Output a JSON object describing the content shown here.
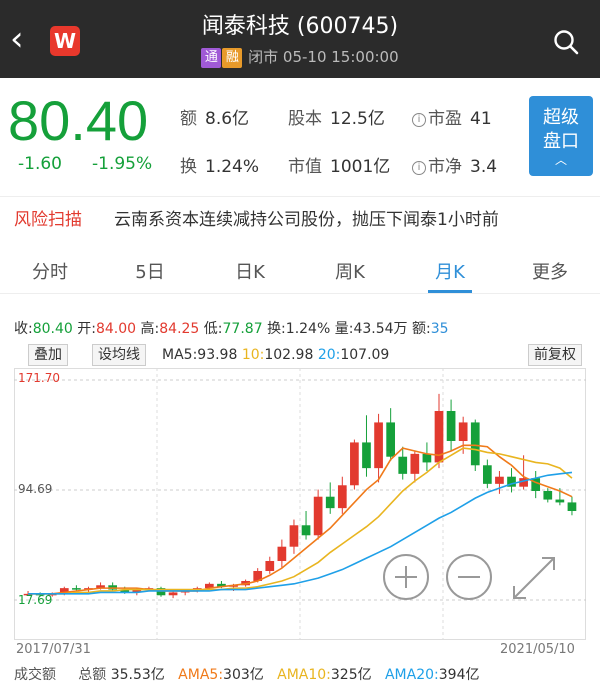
{
  "header": {
    "title": "闻泰科技 (600745)",
    "badge_tong": "通",
    "badge_rong": "融",
    "status": "闭市 05-10 15:00:00",
    "app_logo": "W"
  },
  "quote": {
    "price": "80.40",
    "change": "-1.60",
    "change_pct": "-1.95%",
    "amount_label": "额",
    "amount": "8.6亿",
    "turnover_label": "换",
    "turnover": "1.24%",
    "shares_label": "股本",
    "shares": "12.5亿",
    "mktcap_label": "市值",
    "mktcap": "1001亿",
    "pe_label": "市盈",
    "pe": "41",
    "pb_label": "市净",
    "pb": "3.4",
    "super_btn_line1": "超级",
    "super_btn_line2": "盘口",
    "price_color": "#15a03a"
  },
  "risk": {
    "tag": "风险扫描",
    "message": "云南系资本连续减持公司股份，抛压下闻泰1小时前"
  },
  "tabs": [
    "分时",
    "5日",
    "日K",
    "周K",
    "月K",
    "更多"
  ],
  "active_tab": "月K",
  "ohlc": {
    "close_label": "收:",
    "close": "80.40",
    "open_label": "开:",
    "open": "84.00",
    "high_label": "高:",
    "high": "84.25",
    "low_label": "低:",
    "low": "77.87",
    "turn_label": "换:",
    "turn": "1.24%",
    "vol_label": "量:",
    "vol": "43.54万",
    "amt_label": "额:",
    "amt": "35"
  },
  "chart_toolbar": {
    "overlay": "叠加",
    "set_ma": "设均线",
    "ma5_label": "MA5:",
    "ma5": "93.98",
    "ma10_label": "10:",
    "ma10": "102.98",
    "ma20_label": "20:",
    "ma20": "107.09",
    "adjust": "前复权"
  },
  "chart_data": {
    "type": "candlestick",
    "y_labels": [
      "171.70",
      "94.69",
      "17.69"
    ],
    "ylim": [
      17.69,
      171.7
    ],
    "x_start": "2017/07/31",
    "x_end": "2021/05/10",
    "candles": [
      [
        22,
        24,
        21,
        22
      ],
      [
        22,
        23,
        20,
        21
      ],
      [
        21,
        23,
        20,
        22
      ],
      [
        22,
        27,
        21,
        26
      ],
      [
        26,
        28,
        24,
        25
      ],
      [
        25,
        27,
        23,
        26
      ],
      [
        26,
        30,
        25,
        28
      ],
      [
        28,
        30,
        24,
        25
      ],
      [
        25,
        27,
        22,
        23
      ],
      [
        23,
        26,
        21,
        25
      ],
      [
        25,
        27,
        24,
        26
      ],
      [
        26,
        27,
        20,
        21
      ],
      [
        21,
        24,
        19,
        23
      ],
      [
        23,
        25,
        21,
        24
      ],
      [
        24,
        27,
        23,
        26
      ],
      [
        26,
        30,
        25,
        29
      ],
      [
        29,
        31,
        26,
        27
      ],
      [
        27,
        29,
        24,
        28
      ],
      [
        28,
        32,
        27,
        31
      ],
      [
        31,
        40,
        30,
        38
      ],
      [
        38,
        48,
        36,
        45
      ],
      [
        45,
        60,
        40,
        55
      ],
      [
        55,
        74,
        50,
        70
      ],
      [
        70,
        80,
        60,
        63
      ],
      [
        63,
        95,
        60,
        90
      ],
      [
        90,
        100,
        78,
        82
      ],
      [
        82,
        104,
        78,
        98
      ],
      [
        98,
        130,
        95,
        128
      ],
      [
        128,
        147,
        104,
        110
      ],
      [
        110,
        148,
        100,
        142
      ],
      [
        142,
        152,
        115,
        118
      ],
      [
        118,
        125,
        102,
        106
      ],
      [
        106,
        122,
        100,
        120
      ],
      [
        120,
        128,
        108,
        114
      ],
      [
        114,
        162,
        110,
        150
      ],
      [
        150,
        158,
        122,
        129
      ],
      [
        129,
        146,
        120,
        142
      ],
      [
        142,
        144,
        108,
        112
      ],
      [
        112,
        116,
        96,
        99
      ],
      [
        99,
        108,
        92,
        104
      ],
      [
        104,
        110,
        93,
        97
      ],
      [
        97,
        119,
        95,
        103
      ],
      [
        103,
        108,
        89,
        94
      ],
      [
        94,
        96,
        86,
        88
      ],
      [
        88,
        96,
        84,
        86
      ],
      [
        86,
        90,
        77,
        80
      ]
    ],
    "series": [
      {
        "name": "MA5",
        "color": "#f07a1a",
        "values": [
          22,
          22,
          22,
          23,
          24,
          25,
          26,
          26,
          26,
          26,
          25,
          24,
          24,
          24,
          24,
          26,
          27,
          28,
          29,
          31,
          35,
          40,
          47,
          54,
          61,
          68,
          77,
          86,
          95,
          102,
          116,
          124,
          122,
          120,
          119,
          122,
          126,
          126,
          125,
          118,
          112,
          104,
          100,
          97,
          94,
          90
        ]
      },
      {
        "name": "MA10",
        "color": "#e9b520",
        "values": [
          22,
          22,
          22,
          22,
          23,
          23,
          24,
          24,
          25,
          25,
          25,
          25,
          25,
          25,
          25,
          25,
          25,
          26,
          26,
          27,
          29,
          31,
          34,
          39,
          44,
          51,
          57,
          63,
          69,
          76,
          85,
          94,
          101,
          107,
          114,
          119,
          124,
          123,
          121,
          120,
          118,
          116,
          114,
          113,
          110,
          103
        ]
      },
      {
        "name": "MA20",
        "color": "#1fa0e8",
        "values": [
          22,
          22,
          22,
          22,
          22,
          22,
          23,
          23,
          23,
          23,
          24,
          24,
          24,
          24,
          24,
          24,
          25,
          25,
          25,
          26,
          27,
          28,
          29,
          31,
          33,
          36,
          39,
          43,
          47,
          51,
          55,
          60,
          65,
          70,
          75,
          79,
          84,
          89,
          93,
          96,
          99,
          101,
          103,
          105,
          106,
          107
        ]
      }
    ]
  },
  "bottom": {
    "label": "成交额",
    "total_label": "总额",
    "total": "35.53亿",
    "ama5_label": "AMA5:",
    "ama5": "303亿",
    "ama10_label": "AMA10:",
    "ama10": "325亿",
    "ama20_label": "AMA20:",
    "ama20": "394亿"
  }
}
